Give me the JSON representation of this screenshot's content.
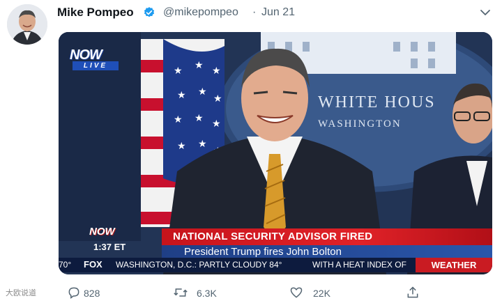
{
  "tweet": {
    "author_name": "Mike Pompeo",
    "handle": "@mikepompeo",
    "separator": "·",
    "date": "Jun 21",
    "icons": {
      "verified": "verified-badge-icon",
      "more": "chevron-down-icon"
    }
  },
  "media": {
    "channel_logo": "NOW",
    "channel_logo_sub": "LIVE",
    "lower_logo": "NOW",
    "time": "1:37 ET",
    "headline": "NATIONAL SECURITY ADVISOR FIRED",
    "subheadline": "President Trump fires John Bolton",
    "ticker": {
      "temp": "70°",
      "network": "FOX",
      "location": "WASHINGTON, D.C.:  PARTLY CLOUDY  84°",
      "detail": "WITH A HEAT INDEX OF",
      "section": "WEATHER"
    },
    "backdrop": {
      "line1": "WHITE HOUS",
      "line2": "WASHINGTON"
    }
  },
  "actions": {
    "reply_count": "828",
    "retweet_count": "6.3K",
    "like_count": "22K",
    "icons": {
      "reply": "reply-icon",
      "retweet": "retweet-icon",
      "like": "heart-icon",
      "share": "share-icon"
    }
  },
  "watermark": "大欧说道"
}
